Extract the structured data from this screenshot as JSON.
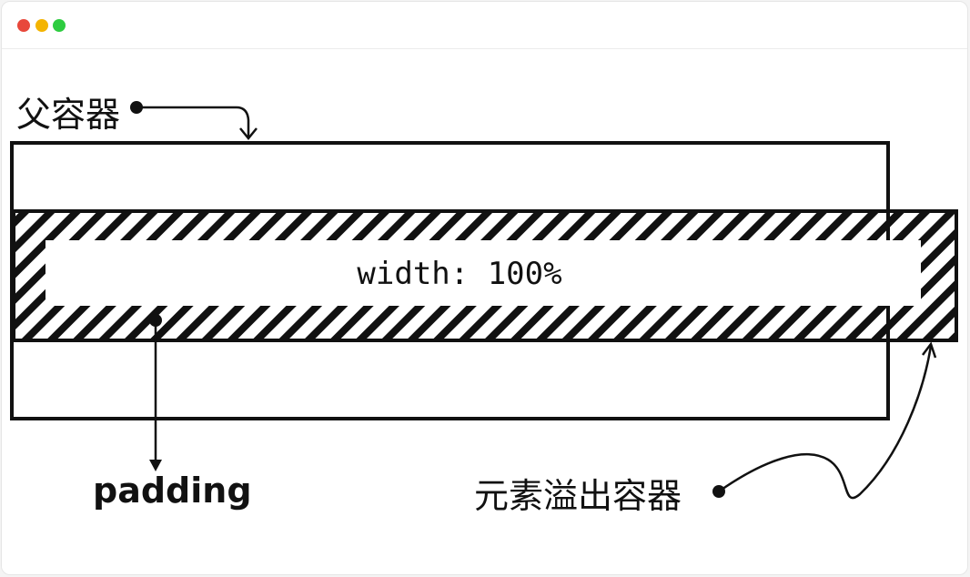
{
  "window": {
    "controls": [
      {
        "name": "close",
        "color": "#e8483b"
      },
      {
        "name": "minimize",
        "color": "#f4b400"
      },
      {
        "name": "maximize",
        "color": "#2ecc40"
      }
    ]
  },
  "diagram": {
    "parent_label": "父容器",
    "child_label": "width: 100%",
    "padding_label": "padding",
    "overflow_label": "元素溢出容器"
  }
}
